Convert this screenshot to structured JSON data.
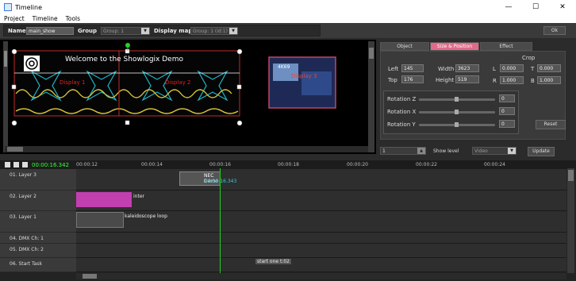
{
  "window": {
    "title": "Timeline"
  },
  "menu": [
    "Project",
    "Timeline",
    "Tools"
  ],
  "toolbar": {
    "name_label": "Name",
    "name_value": "main_show",
    "group_label": "Group",
    "group_value": "Group: 1",
    "display_map_label": "Display map",
    "display_map_value": "Group: 1  (id:1)",
    "ok_label": "Ok"
  },
  "preview": {
    "banner": "Welcome to the Showlogix Demo",
    "display1": "Display 1",
    "display2": "Display 2",
    "display3": "Display 3",
    "thumb_text": "4K69"
  },
  "tabs": [
    "Object",
    "Size & Position",
    "Effect"
  ],
  "size": {
    "left_label": "Left",
    "left_value": "145",
    "top_label": "Top",
    "top_value": "176",
    "width_label": "Width",
    "width_value": "3623",
    "height_label": "Height",
    "height_value": "519"
  },
  "crop": {
    "title": "Crop",
    "l_label": "L",
    "l_value": "0.000",
    "t_label": "T",
    "t_value": "0.000",
    "r_label": "R",
    "r_value": "1.000",
    "b_label": "B",
    "b_value": "1.000"
  },
  "rotation": [
    {
      "label": "Rotation Z",
      "value": "0"
    },
    {
      "label": "Rotation X",
      "value": "0"
    },
    {
      "label": "Rotation Y",
      "value": "0"
    }
  ],
  "reset_label": "Reset",
  "bottom": {
    "field_value": "1",
    "show_level_label": "Show level",
    "show_level_value": "Video",
    "update_label": "Update"
  },
  "timeline": {
    "timecode": "00:00:16.342",
    "ticks": [
      "00:00:12",
      "00:00:14",
      "00:00:16",
      "00:00:18",
      "00:00:20",
      "00:00:22",
      "00:00:24"
    ],
    "layers": [
      {
        "label": "01. Layer 3"
      },
      {
        "label": "02. Layer 2"
      },
      {
        "label": "03. Layer 1"
      },
      {
        "label": "04.  DMX  Ch: 1"
      },
      {
        "label": "05.  DMX  Ch: 2"
      },
      {
        "label": "06.  Start Task"
      }
    ],
    "clips": {
      "nec": "NEC Demo",
      "nec_time": "00:00:16.343",
      "inter": "inter",
      "kaleido": "kaleidoscope  loop",
      "start": "start one t:02"
    }
  },
  "colors": {
    "accent_pink": "#e06a8a",
    "playhead": "#22d022",
    "timecode": "#3cff3c"
  }
}
